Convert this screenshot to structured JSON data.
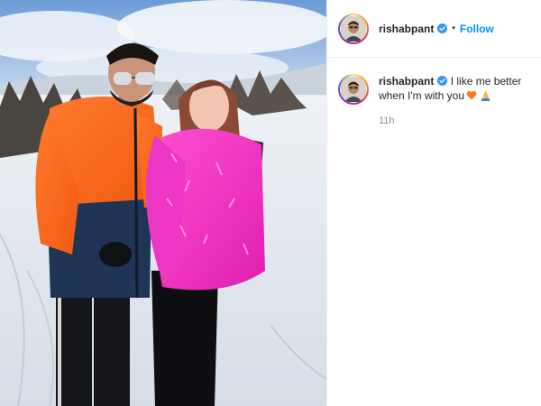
{
  "post": {
    "username": "rishabpant",
    "follow_label": "Follow",
    "separator": "•",
    "caption_username": "rishabpant",
    "caption_text": "I like me better when I'm with you",
    "timestamp": "11h",
    "icons": {
      "verified": "verified-badge-icon",
      "heart": "orange-heart-icon",
      "hands": "folded-hands-icon"
    },
    "colors": {
      "follow": "#0095f6",
      "verified": "#3897f0",
      "heart": "#f47b20",
      "muted": "#8e8e8e"
    }
  }
}
